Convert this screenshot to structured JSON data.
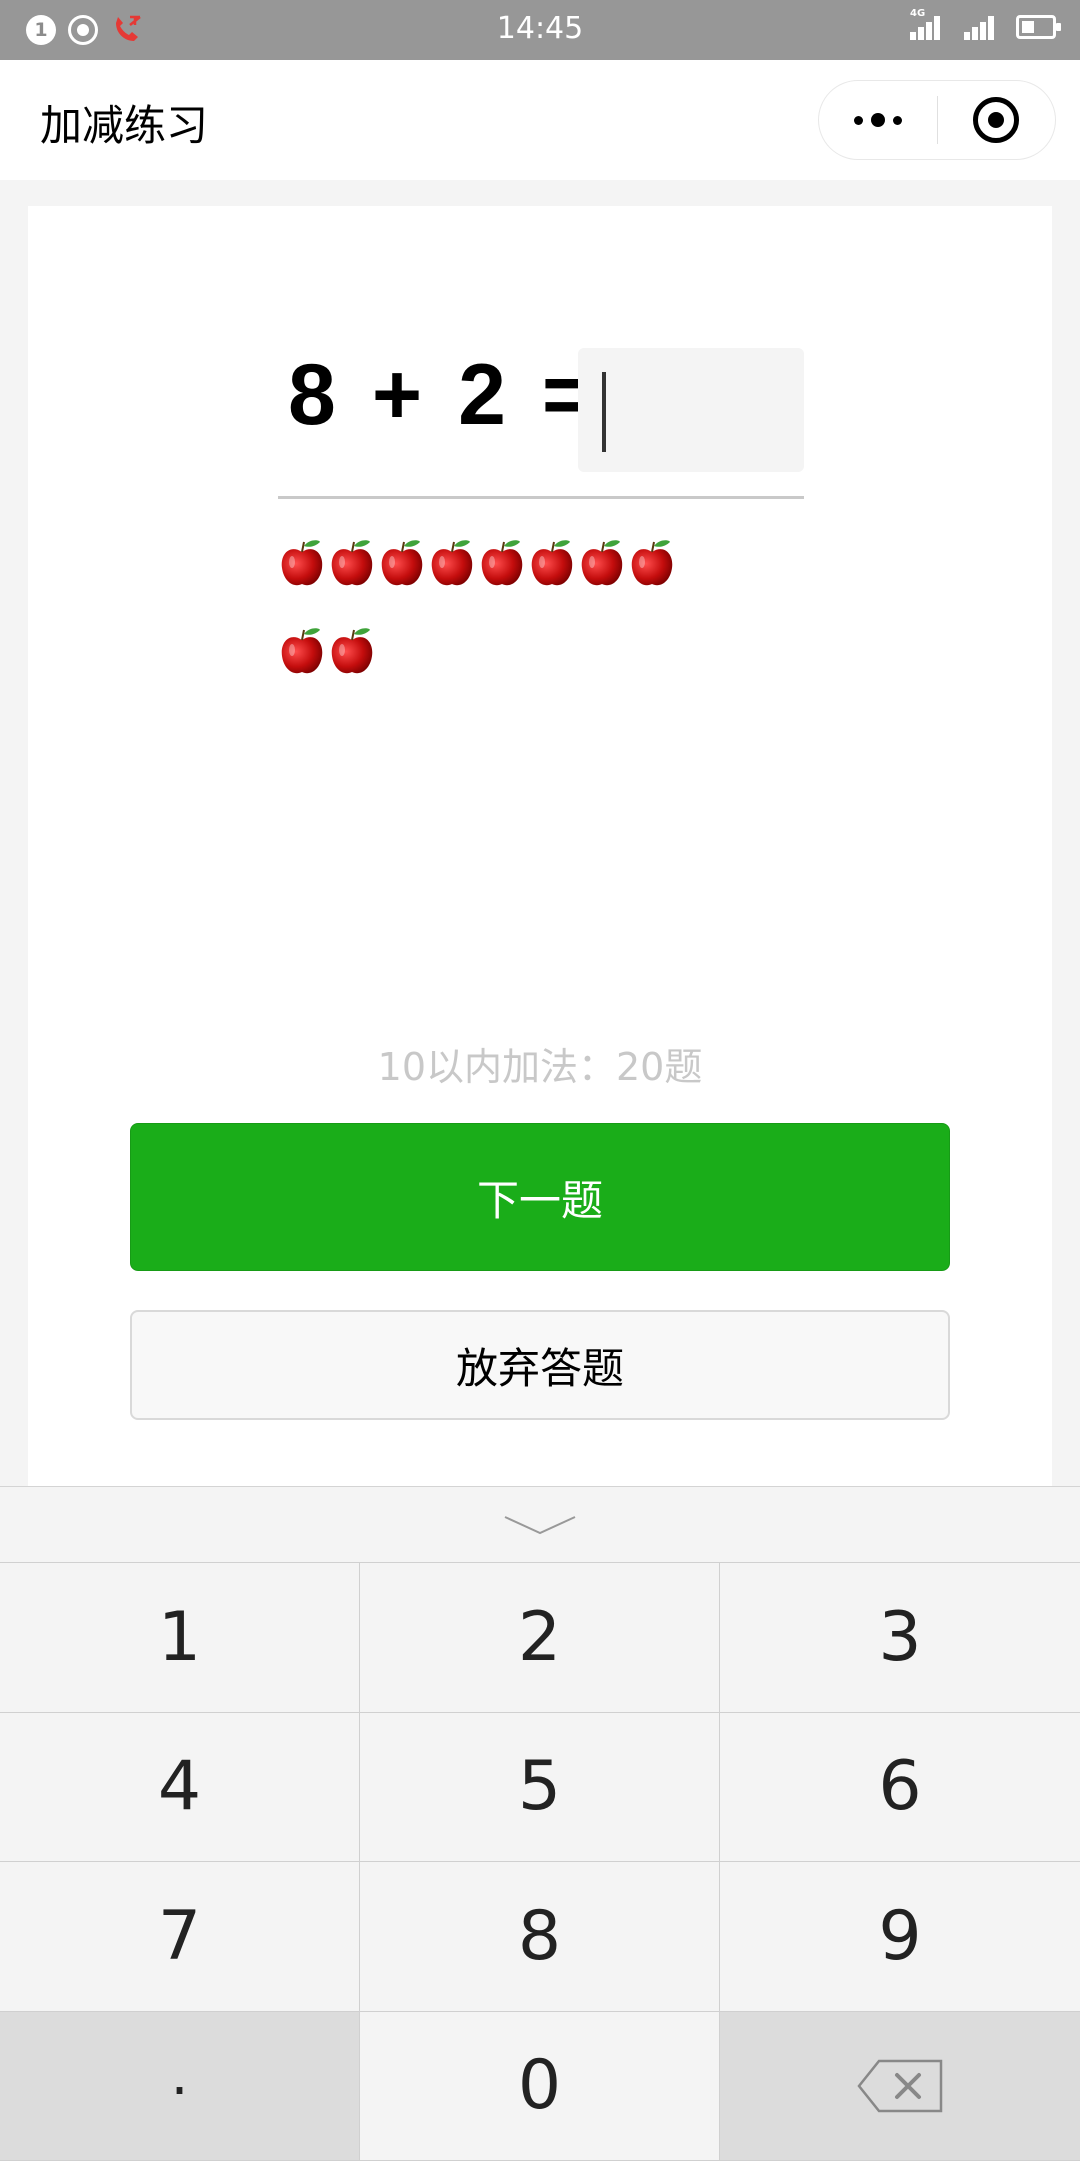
{
  "status_bar": {
    "time": "14:45",
    "notification_count": "1",
    "network_type": "4G",
    "sim1": "1",
    "sim2": "2"
  },
  "nav": {
    "title": "加减练习"
  },
  "question": {
    "operand_a": "8",
    "operator": "+",
    "operand_b": "2",
    "equals": "=",
    "answer_value": ""
  },
  "apples": {
    "row1_count": 8,
    "row2_count": 2,
    "icon": "apple-icon"
  },
  "hint": "10以内加法：20题",
  "buttons": {
    "next_label": "下一题",
    "quit_label": "放弃答题",
    "next_color": "#1aad19"
  },
  "keyboard": {
    "keys": [
      "1",
      "2",
      "3",
      "4",
      "5",
      "6",
      "7",
      "8",
      "9",
      ".",
      "0"
    ],
    "collapse_icon": "chevron-down-icon",
    "delete_icon": "backspace-icon"
  }
}
